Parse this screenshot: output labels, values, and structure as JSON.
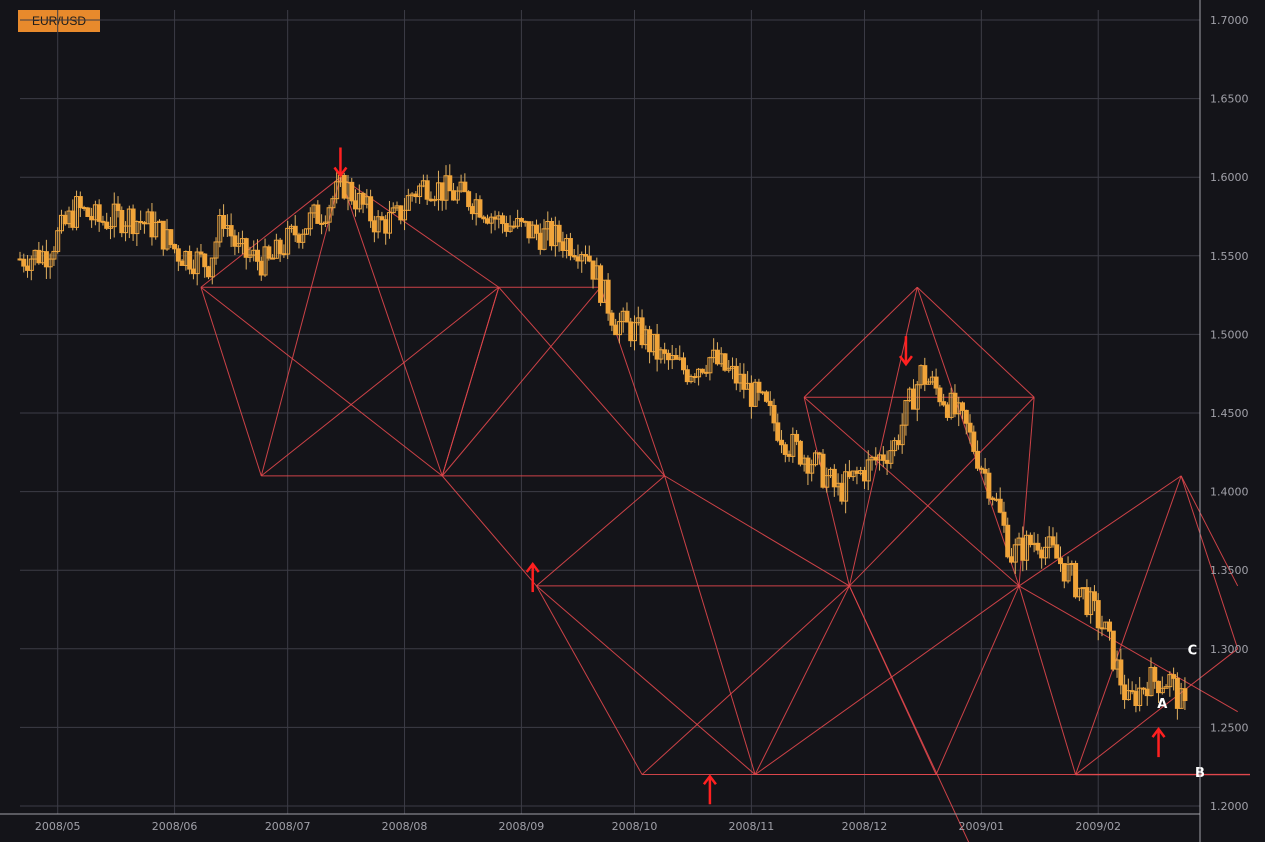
{
  "symbol": "EUR/USD",
  "colors": {
    "background": "#141419",
    "grid": "#3c3c46",
    "axis": "#a0a0a8",
    "candle_up": "#f0a43a",
    "candle_down": "#f0a43a",
    "wick": "#e0b060",
    "pattern_lines": "#e0474c",
    "arrows": "#ff2020",
    "point_labels": "#ffffff"
  },
  "chart_data": {
    "type": "candlestick",
    "title": "",
    "xlabel": "",
    "ylabel": "",
    "ylim": [
      1.2,
      1.7
    ],
    "grid": true,
    "y_ticks": [
      "1.2000",
      "1.2500",
      "1.3000",
      "1.3500",
      "1.4000",
      "1.4500",
      "1.5000",
      "1.5500",
      "1.6000",
      "1.6500",
      "1.7000"
    ],
    "x_ticks": [
      "2008/05",
      "2008/06",
      "2008/07",
      "2008/08",
      "2008/09",
      "2008/10",
      "2008/11",
      "2008/12",
      "2009/01",
      "2009/02"
    ],
    "x_tick_dates": [
      "2008-05-01",
      "2008-06-01",
      "2008-07-01",
      "2008-08-01",
      "2008-09-01",
      "2008-10-01",
      "2008-11-01",
      "2008-12-01",
      "2009-01-01",
      "2009-02-01"
    ],
    "x_range": [
      "2008-04-21",
      "2009-02-28"
    ],
    "close_path": [
      [
        "2008-04-21",
        1.548
      ],
      [
        "2008-04-28",
        1.552
      ],
      [
        "2008-05-06",
        1.58
      ],
      [
        "2008-05-12",
        1.572
      ],
      [
        "2008-05-20",
        1.575
      ],
      [
        "2008-05-27",
        1.568
      ],
      [
        "2008-06-02",
        1.552
      ],
      [
        "2008-06-10",
        1.545
      ],
      [
        "2008-06-14",
        1.575
      ],
      [
        "2008-06-18",
        1.552
      ],
      [
        "2008-06-26",
        1.545
      ],
      [
        "2008-07-03",
        1.565
      ],
      [
        "2008-07-10",
        1.578
      ],
      [
        "2008-07-16",
        1.595
      ],
      [
        "2008-07-25",
        1.57
      ],
      [
        "2008-07-30",
        1.574
      ],
      [
        "2008-08-03",
        1.59
      ],
      [
        "2008-08-07",
        1.596
      ],
      [
        "2008-08-13",
        1.59
      ],
      [
        "2008-08-20",
        1.585
      ],
      [
        "2008-08-26",
        1.572
      ],
      [
        "2008-09-04",
        1.565
      ],
      [
        "2008-09-12",
        1.56
      ],
      [
        "2008-09-18",
        1.555
      ],
      [
        "2008-09-22",
        1.53
      ],
      [
        "2008-09-26",
        1.508
      ],
      [
        "2008-10-03",
        1.5
      ],
      [
        "2008-10-08",
        1.485
      ],
      [
        "2008-10-15",
        1.477
      ],
      [
        "2008-10-21",
        1.485
      ],
      [
        "2008-10-28",
        1.472
      ],
      [
        "2008-11-04",
        1.455
      ],
      [
        "2008-11-11",
        1.43
      ],
      [
        "2008-11-17",
        1.42
      ],
      [
        "2008-11-24",
        1.4
      ],
      [
        "2008-12-02",
        1.416
      ],
      [
        "2008-12-09",
        1.43
      ],
      [
        "2008-12-16",
        1.475
      ],
      [
        "2008-12-22",
        1.46
      ],
      [
        "2008-12-28",
        1.44
      ],
      [
        "2009-01-04",
        1.4
      ],
      [
        "2009-01-09",
        1.36
      ],
      [
        "2009-01-16",
        1.37
      ],
      [
        "2009-01-22",
        1.355
      ],
      [
        "2009-01-28",
        1.335
      ],
      [
        "2009-02-03",
        1.31
      ],
      [
        "2009-02-09",
        1.265
      ],
      [
        "2009-02-14",
        1.28
      ],
      [
        "2009-02-20",
        1.28
      ],
      [
        "2009-02-24",
        1.26
      ]
    ],
    "annotations": [
      {
        "type": "arrow",
        "direction": "down",
        "date": "2008-07-15",
        "price": 1.61
      },
      {
        "type": "arrow",
        "direction": "up",
        "date": "2008-09-04",
        "price": 1.345
      },
      {
        "type": "arrow",
        "direction": "up",
        "date": "2008-10-21",
        "price": 1.21
      },
      {
        "type": "arrow",
        "direction": "down",
        "date": "2008-12-12",
        "price": 1.49
      },
      {
        "type": "arrow",
        "direction": "up",
        "date": "2009-02-17",
        "price": 1.24
      },
      {
        "type": "label",
        "text": "A",
        "date": "2009-02-18",
        "price": 1.2655
      },
      {
        "type": "label",
        "text": "B",
        "date": "2009-02-28",
        "price": 1.2215
      },
      {
        "type": "label",
        "text": "C",
        "date": "2009-02-26",
        "price": 1.2995
      }
    ],
    "pattern_points": [
      [
        [
          0,
          0.5575
        ],
        [
          8,
          0.65
        ],
        [
          13,
          0.64
        ],
        [
          20,
          0.61
        ]
      ],
      [
        [
          0,
          0.585
        ],
        [
          3,
          0.6
        ],
        [
          6,
          0.6
        ],
        [
          8,
          0.615
        ]
      ]
    ]
  }
}
